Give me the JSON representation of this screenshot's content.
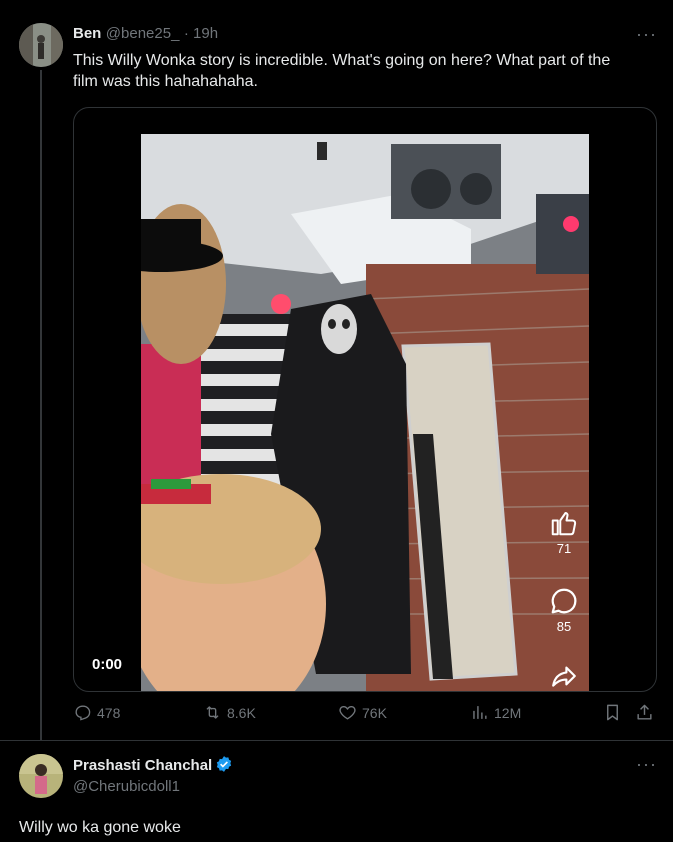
{
  "tweet1": {
    "name": "Ben",
    "handle": "@bene25_",
    "time": "· 19h",
    "text_line1": "This Willy Wonka story is incredible. What's going on here? What part of the",
    "text_line2": "film was this hahahahaha.",
    "video": {
      "timestamp": "0:00",
      "likes": "71",
      "comments": "85"
    },
    "stats": {
      "replies": "478",
      "retweets": "8.6K",
      "likes": "76K",
      "views": "12M"
    }
  },
  "tweet2": {
    "name": "Prashasti Chanchal",
    "handle": "@Cherubicdoll1",
    "text": "Willy wo ka gone woke"
  },
  "icons": {
    "more": "more-dots-icon",
    "reply": "reply-icon",
    "retweet": "retweet-icon",
    "like": "heart-icon",
    "views": "views-icon",
    "bookmark": "bookmark-icon",
    "share": "share-icon",
    "verified": "verified-badge-icon"
  },
  "colors": {
    "background": "#000000",
    "text": "#e7e9ea",
    "muted": "#71767b",
    "verified": "#1d9bf0"
  }
}
